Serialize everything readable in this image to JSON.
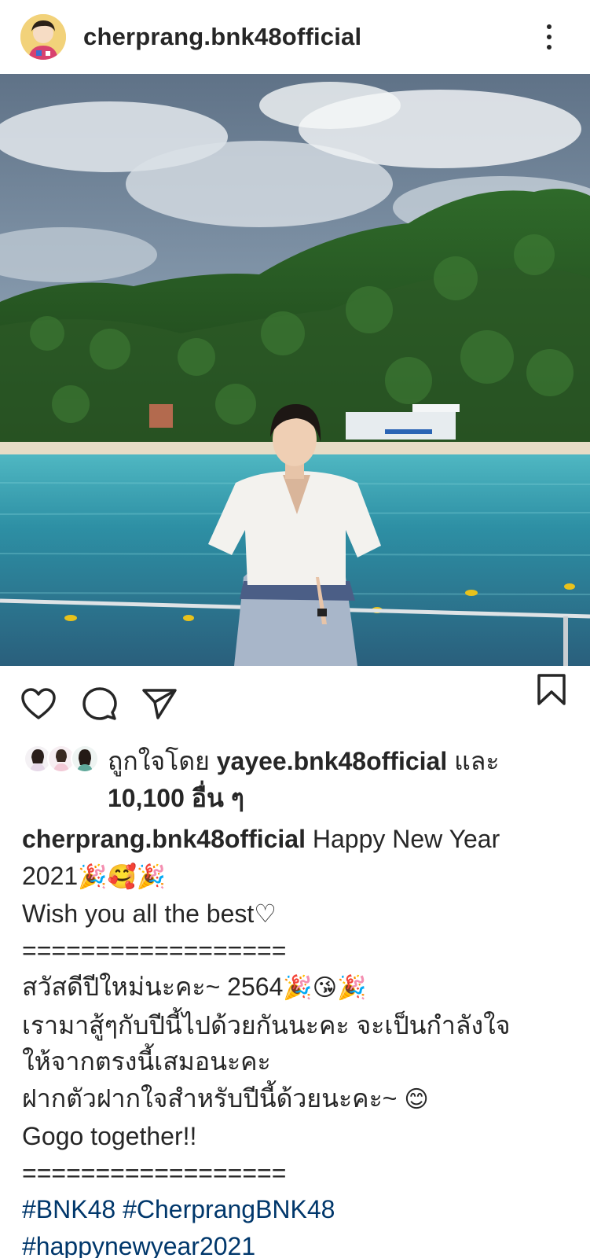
{
  "post": {
    "username": "cherprang.bnk48official"
  },
  "icons": {
    "more": "more-vertical-icon",
    "like": "heart-icon",
    "comment": "comment-icon",
    "share": "paper-plane-icon",
    "save": "bookmark-icon"
  },
  "likes": {
    "prefix": "ถูกใจโดย",
    "liker": "yayee.bnk48official",
    "conj": "และ",
    "others": "10,100 อื่น ๆ"
  },
  "caption": {
    "username": "cherprang.bnk48official",
    "line1_text": "Happy New Year",
    "line2_text": "2021",
    "line2_emojis": "🎉🥰🎉",
    "line3": "Wish you all the best♡",
    "divider1": "==================",
    "line5_text": "สวัสดีปีใหม่นะคะ~ 2564",
    "line5_emojis": "🎉😘🎉",
    "line6": "เรามาสู้ๆกับปีนี้ไปด้วยกันนะคะ จะเป็นกำลังใจ",
    "line7": "ให้จากตรงนี้เสมอนะคะ",
    "line8_text": "ฝากตัวฝากใจสำหรับปีนี้ด้วยนะคะ~",
    "line8_emoji": "😊",
    "line9": "Gogo together!!",
    "divider2": "==================",
    "hashtags_line1": "#BNK48 #CherprangBNK48",
    "hashtags_line2": "#happynewyear2021"
  },
  "colors": {
    "text": "#262626",
    "hashtag": "#00376b",
    "background": "#ffffff"
  }
}
